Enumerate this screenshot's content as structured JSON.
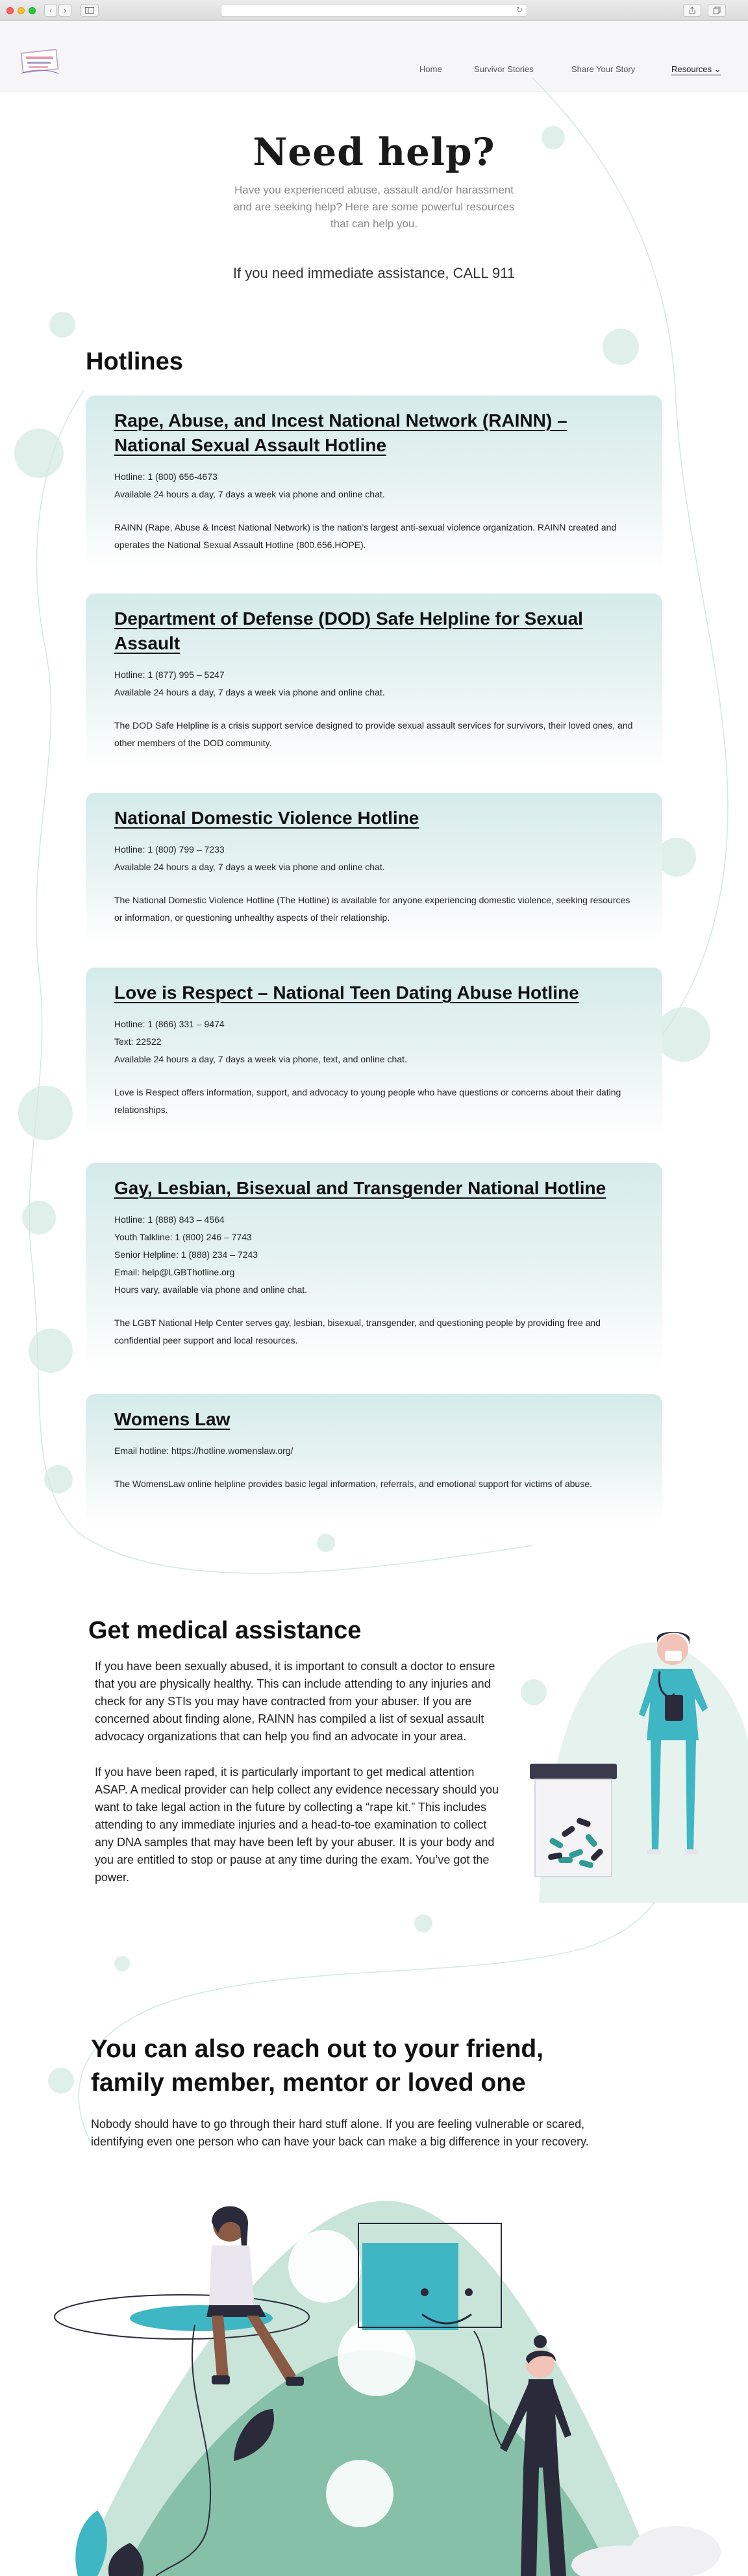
{
  "browser": {
    "nav_back": "‹",
    "nav_forward": "›",
    "reload": "↻",
    "sidebar_icon": "sidebar-icon",
    "share_icon": "share-icon",
    "tabs_icon": "tabs-icon"
  },
  "header": {
    "logo_icon": "site-logo-icon",
    "nav": [
      {
        "label": "Home"
      },
      {
        "label": "Survivor Stories"
      },
      {
        "label": "Share Your Story"
      },
      {
        "label": "Resources ⌄"
      }
    ]
  },
  "hero": {
    "title": "Need help?",
    "subtitle": "Have you experienced abuse, assault and/or harassment and are seeking help? Here are some powerful resources that can help you.",
    "emergency": "If you need immediate assistance, CALL 911"
  },
  "hotlines": {
    "heading": "Hotlines",
    "cards": [
      {
        "title": "Rape, Abuse, and Incest National Network (RAINN) – National Sexual Assault Hotline",
        "lines": [
          "Hotline: 1 (800) 656-4673",
          "Available 24 hours a day, 7 days a week via phone and online chat."
        ],
        "description": "RAINN (Rape, Abuse & Incest National Network) is the nation’s largest anti-sexual violence organization. RAINN created and operates the National Sexual Assault Hotline (800.656.HOPE)."
      },
      {
        "title": "Department of Defense (DOD) Safe Helpline for Sexual Assault",
        "lines": [
          "Hotline: 1 (877) 995 – 5247",
          "Available 24 hours a day, 7 days a week via phone and online chat."
        ],
        "description": "The DOD Safe Helpline is a crisis support service designed to provide sexual assault services for survivors, their loved ones, and other members of the DOD community."
      },
      {
        "title": "National Domestic Violence Hotline",
        "lines": [
          "Hotline: 1 (800) 799 – 7233",
          "Available 24 hours a day, 7 days a week via phone and online chat."
        ],
        "description": "The National Domestic Violence Hotline (The Hotline) is available for anyone experiencing domestic violence, seeking resources or information, or questioning unhealthy aspects of their relationship."
      },
      {
        "title": "Love is Respect – National Teen Dating Abuse Hotline",
        "lines": [
          "Hotline: 1 (866) 331 – 9474",
          "Text: 22522",
          "Available 24 hours a day, 7 days a week via phone, text, and online chat."
        ],
        "description": "Love is Respect offers information, support, and advocacy to young people who have questions or concerns about their dating relationships."
      },
      {
        "title": "Gay, Lesbian, Bisexual and Transgender National Hotline",
        "lines": [
          "Hotline: 1 (888) 843 – 4564",
          "Youth Talkline: 1 (800) 246 – 7743",
          "Senior Helpline: 1 (888) 234 – 7243",
          "Email: help@LGBThotline.org",
          "Hours vary, available via phone and online chat."
        ],
        "description": "The LGBT National Help Center serves gay, lesbian, bisexual, transgender, and questioning people by providing free and confidential peer support and local resources."
      },
      {
        "title": "Womens Law",
        "lines": [
          "Email hotline: https://hotline.womenslaw.org/"
        ],
        "description": "The WomensLaw online helpline provides basic legal information, referrals, and emotional support for victims of abuse."
      }
    ]
  },
  "medical": {
    "heading": "Get medical assistance",
    "paragraphs": [
      "If you have been sexually abused, it is important to consult a doctor to ensure that you are physically healthy. This can include attending to any injuries and check for any STIs you may have contracted from your abuser. If you are concerned about finding alone, RAINN has compiled a list of sexual assault advocacy organizations that can help you find an advocate in your area.",
      "If you have been raped, it is particularly important to get medical attention ASAP. A medical provider can help collect any evidence necessary should you want to take legal action in the future by collecting a “rape kit.” This includes attending to any immediate injuries and a head-to-toe examination to collect any DNA samples that may have been left by your abuser. It is your body and you are entitled to stop or pause at any time during the exam. You’ve got the power."
    ],
    "illustration": "doctor-illustration-icon"
  },
  "friends": {
    "heading": "You can also reach out to your friend, family member, mentor or loved one",
    "paragraph": "Nobody should have to go through their hard stuff alone. If you are feeling vulnerable or scared, identifying even one person who can have your back can make a big difference in your recovery.",
    "illustration": "friends-support-illustration-icon"
  },
  "colors": {
    "accent_teal": "#3fb6c3",
    "card_tint": "#d4ebea",
    "mint": "#79b8a2",
    "ink": "#2b2a3a"
  }
}
